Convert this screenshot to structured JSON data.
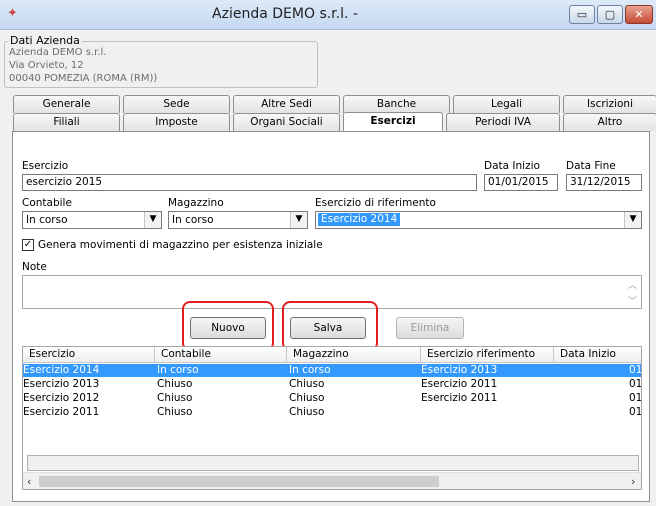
{
  "window": {
    "title": "Azienda DEMO s.r.l. -",
    "minimize": "▭",
    "maximize": "▢",
    "close": "✕"
  },
  "company": {
    "legend": "Dati Azienda",
    "name": "Azienda DEMO s.r.l.",
    "address": "Via Orvieto, 12",
    "city": "00040 POMEZIA (ROMA (RM))"
  },
  "tabs_row1": [
    "Generale",
    "Sede",
    "Altre Sedi",
    "Banche",
    "Legali",
    "Iscrizioni"
  ],
  "tabs_row2": [
    "Filiali",
    "Imposte",
    "Organi Sociali",
    "Esercizi",
    "Periodi IVA",
    "Altro"
  ],
  "form": {
    "esercizio_label": "Esercizio",
    "esercizio_value": "esercizio 2015",
    "data_inizio_label": "Data Inizio",
    "data_inizio_value": "01/01/2015",
    "data_fine_label": "Data Fine",
    "data_fine_value": "31/12/2015",
    "contabile_label": "Contabile",
    "contabile_value": "In corso",
    "magazzino_label": "Magazzino",
    "magazzino_value": "In corso",
    "riferimento_label": "Esercizio di riferimento",
    "riferimento_value": "Esercizio 2014",
    "checkbox_label": "Genera movimenti di magazzino per esistenza iniziale",
    "checkbox_checked": true,
    "note_label": "Note",
    "note_value": ""
  },
  "buttons": {
    "nuovo": "Nuovo",
    "salva": "Salva",
    "elimina": "Elimina"
  },
  "grid": {
    "columns": [
      "Esercizio",
      "Contabile",
      "Magazzino",
      "Esercizio riferimento",
      "Data Inizio"
    ],
    "rows": [
      [
        "Esercizio 2014",
        "In corso",
        "In corso",
        "Esercizio 2013",
        "01"
      ],
      [
        "Esercizio 2013",
        "Chiuso",
        "Chiuso",
        "Esercizio 2011",
        "01"
      ],
      [
        "Esercizio 2012",
        "Chiuso",
        "Chiuso",
        "Esercizio 2011",
        "01"
      ],
      [
        "Esercizio 2011",
        "Chiuso",
        "Chiuso",
        "",
        "01"
      ]
    ],
    "selected_row": 0
  },
  "colors": {
    "selection": "#3399ff",
    "highlight": "#e02020"
  }
}
